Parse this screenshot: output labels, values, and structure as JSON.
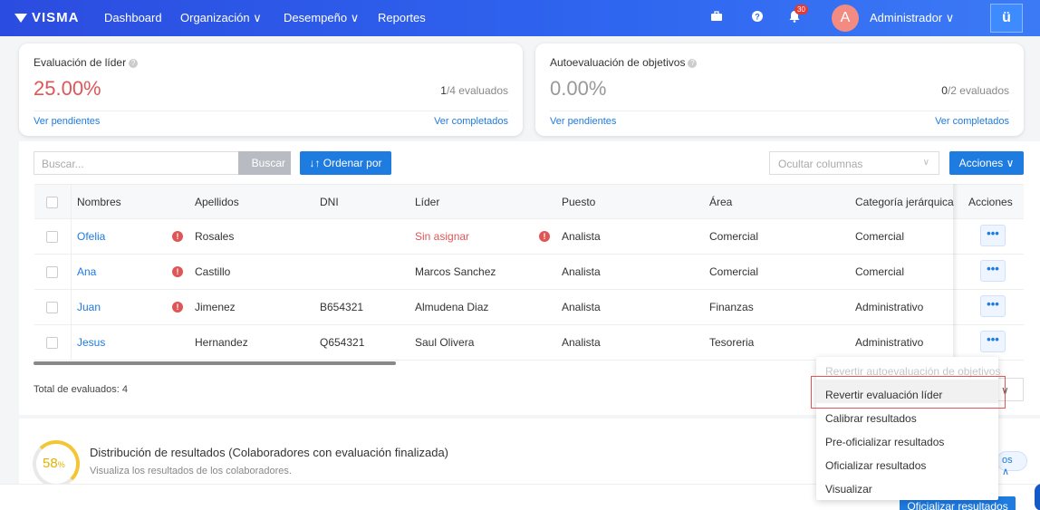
{
  "nav": {
    "logo": "VISMA",
    "items": [
      "Dashboard",
      "Organización ∨",
      "Desempeño ∨",
      "Reportes"
    ],
    "notif_count": "30",
    "avatar_letter": "A",
    "user": "Administrador ∨",
    "app_glyph": "ü"
  },
  "cards": [
    {
      "title": "Evaluación de líder",
      "pct": "25.00%",
      "count_done": "1",
      "count_rest": "/4 evaluados",
      "link_left": "Ver pendientes",
      "link_right": "Ver completados",
      "pct_color": "#e05656"
    },
    {
      "title": "Autoevaluación de objetivos",
      "pct": "0.00%",
      "count_done": "0",
      "count_rest": "/2 evaluados",
      "link_left": "Ver pendientes",
      "link_right": "Ver completados",
      "pct_color": "#999999"
    }
  ],
  "toolbar": {
    "search_placeholder": "Buscar...",
    "buscar": "Buscar",
    "ordenar": "↓↑ Ordenar por",
    "ocultar": "Ocultar columnas",
    "acciones": "Acciones ∨"
  },
  "table": {
    "headers": [
      "Nombres",
      "Apellidos",
      "DNI",
      "Líder",
      "Puesto",
      "Área",
      "Categoría jerárquica",
      "Acciones"
    ],
    "rows": [
      {
        "nombre": "Ofelia",
        "apellido": "Rosales",
        "dni": "",
        "lider": "Sin asignar",
        "puesto": "Analista",
        "area": "Comercial",
        "categoria": "Comercial",
        "warn_name": true,
        "warn_lider": true
      },
      {
        "nombre": "Ana",
        "apellido": "Castillo",
        "dni": "",
        "lider": "Marcos Sanchez",
        "puesto": "Analista",
        "area": "Comercial",
        "categoria": "Comercial",
        "warn_name": true,
        "warn_lider": false
      },
      {
        "nombre": "Juan",
        "apellido": "Jimenez",
        "dni": "B654321",
        "lider": "Almudena Diaz",
        "puesto": "Analista",
        "area": "Finanzas",
        "categoria": "Administrativo",
        "warn_name": true,
        "warn_lider": false
      },
      {
        "nombre": "Jesus",
        "apellido": "Hernandez",
        "dni": "Q654321",
        "lider": "Saul Olivera",
        "puesto": "Analista",
        "area": "Tesoreria",
        "categoria": "Administrativo",
        "warn_name": false,
        "warn_lider": false
      }
    ],
    "total": "Total de evaluados: 4",
    "actions_glyph": "•••",
    "warn_glyph": "!"
  },
  "partial": {
    "select": "a ∨",
    "pill": "os ∧"
  },
  "distribution": {
    "percent": "58",
    "percent_sign": "%",
    "title": "Distribución de resultados",
    "title_suffix": " (Colaboradores con evaluación finalizada)",
    "subtitle": "Visualiza los resultados de los colaboradores."
  },
  "bottom": {
    "oficializar": "Oficializar resultados"
  },
  "menu": {
    "items": [
      {
        "label": "Revertir autoevaluación de objetivos",
        "disabled": true
      },
      {
        "label": "Revertir evaluación líder",
        "disabled": false
      },
      {
        "label": "Calibrar resultados",
        "disabled": false
      },
      {
        "label": "Pre-oficializar resultados",
        "disabled": false
      },
      {
        "label": "Oficializar resultados",
        "disabled": false
      },
      {
        "label": "Visualizar",
        "disabled": false
      }
    ]
  }
}
